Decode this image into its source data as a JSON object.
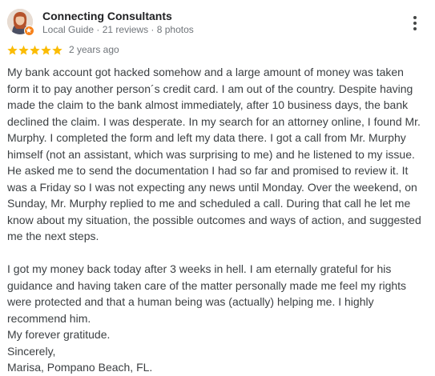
{
  "reviewer": {
    "name": "Connecting Consultants",
    "badge": "Local Guide",
    "reviews": "21 reviews",
    "photos": "8 photos",
    "separator": " · ",
    "avatar_icon": "profile-photo",
    "badge_icon": "local-guide-star-icon"
  },
  "menu_icon": "more-vert-icon",
  "rating": {
    "stars": 5,
    "max_stars": 5,
    "star_color": "#fbbc04",
    "date": "2 years ago"
  },
  "review": {
    "paragraph1": "My bank account got hacked somehow and a large amount of money was taken form it to pay another person´s credit card. I am out of the country. Despite having made the claim to the bank almost immediately, after 10 business days, the bank declined the claim. I was desperate. In my search for an attorney online, I found Mr. Murphy. I completed the form and left my data there. I got a call from Mr. Murphy himself (not an assistant, which was surprising to me) and he listened to my issue. He asked me to send the documentation I had so far and promised to review it. It was a Friday so I was not expecting any news until Monday. Over the weekend, on Sunday, Mr. Murphy replied to me and scheduled a call. During that call he let me know about my situation, the possible outcomes and ways of action, and suggested me the next steps.",
    "paragraph2": "I got my money back today after 3 weeks in hell. I am eternally grateful for his guidance and having taken care of the matter personally made me feel my rights were protected and that a human being was (actually) helping me. I highly recommend him.",
    "closing1": "My forever gratitude.",
    "closing2": "Sincerely,",
    "signature": "Marisa, Pompano Beach, FL."
  },
  "colors": {
    "text": "#3c4043",
    "secondary": "#70757a",
    "badge": "#f7821b"
  }
}
